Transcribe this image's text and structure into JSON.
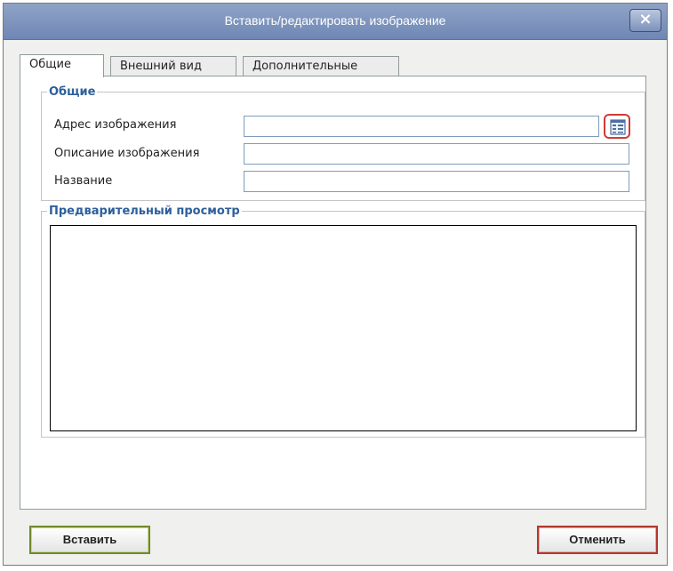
{
  "window": {
    "title": "Вставить/редактировать изображение",
    "close_label": "×"
  },
  "tabs": [
    {
      "label": "Общие",
      "active": true
    },
    {
      "label": "Внешний вид",
      "active": false
    },
    {
      "label": "Дополнительные",
      "active": false
    }
  ],
  "general": {
    "legend": "Общие",
    "image_url": {
      "label": "Адрес изображения",
      "value": ""
    },
    "image_description": {
      "label": "Описание изображения",
      "value": ""
    },
    "title": {
      "label": "Название",
      "value": ""
    },
    "browse_icon": "file-browser-icon"
  },
  "preview": {
    "legend": "Предварительный просмотр"
  },
  "buttons": {
    "insert": "Вставить",
    "cancel": "Отменить"
  },
  "colors": {
    "titlebar": "#7a8fbb",
    "legend": "#2d5f9b",
    "insert_border": "#6f8a2a",
    "cancel_border": "#b3382e"
  }
}
